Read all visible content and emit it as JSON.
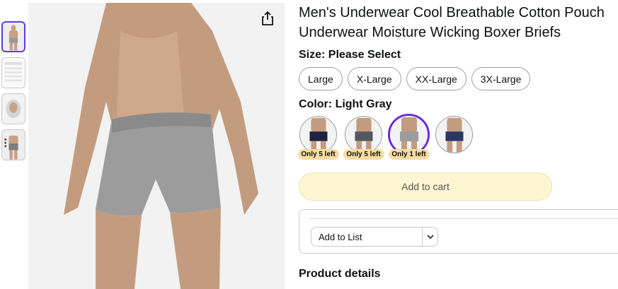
{
  "product": {
    "title_line1": "Men's Underwear Cool Breathable Cotton Pouch",
    "title_line2": "Underwear Moisture Wicking Boxer Briefs"
  },
  "size": {
    "label": "Size:",
    "selected": "Please Select",
    "options": [
      "Large",
      "X-Large",
      "XX-Large",
      "3X-Large"
    ]
  },
  "color": {
    "label": "Color:",
    "selected": "Light Gray",
    "swatches": [
      {
        "name": "navy",
        "badge": "Only 5 left"
      },
      {
        "name": "dark-gray",
        "badge": "Only 5 left"
      },
      {
        "name": "light-gray",
        "badge": "Only 1 left"
      },
      {
        "name": "navy-blue",
        "badge": ""
      }
    ]
  },
  "actions": {
    "add_to_cart": "Add to cart",
    "add_to_list": "Add to List"
  },
  "sections": {
    "product_details": "Product details"
  },
  "icons": {
    "share": "share-icon",
    "dropdown": "chevron-down-icon"
  },
  "colors": {
    "accent": "#6b2bd8",
    "badge_bg": "#f7dca3",
    "cart_bg": "#fcf6d3"
  }
}
